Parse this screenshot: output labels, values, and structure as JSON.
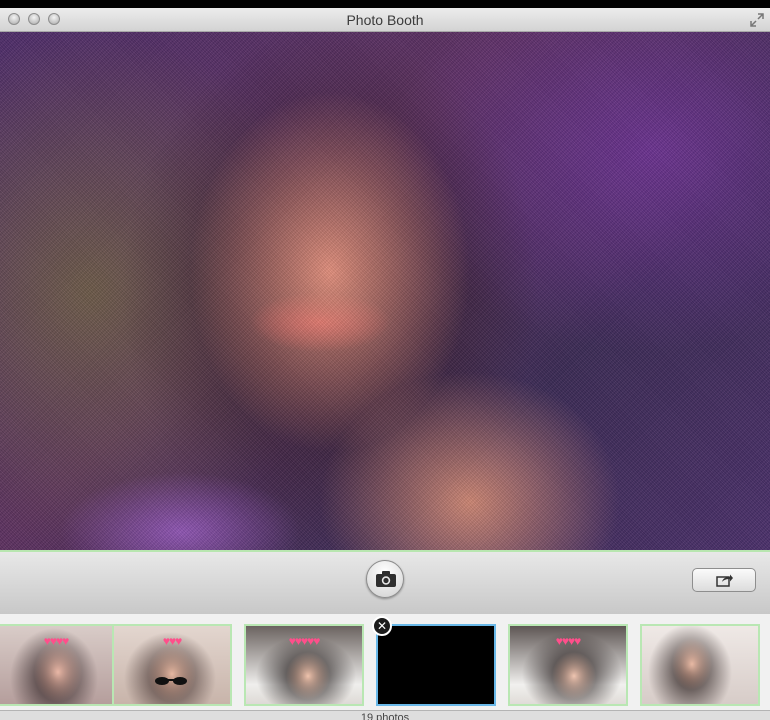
{
  "window": {
    "title": "Photo Booth"
  },
  "toolbar": {
    "capture_icon": "camera-icon",
    "share_icon": "share-icon"
  },
  "strip": {
    "thumbnails": [
      {
        "label": "photo-1",
        "effect": "heart crown"
      },
      {
        "label": "photo-2",
        "effect": "heart crown, sunglasses"
      },
      {
        "label": "photo-3",
        "effect": "heart crown"
      },
      {
        "label": "photo-4",
        "effect": "black / selected"
      },
      {
        "label": "photo-5",
        "effect": "heart crown"
      },
      {
        "label": "photo-6",
        "effect": "none"
      }
    ],
    "delete_glyph": "✕"
  },
  "status": {
    "count_text": "19 photos"
  },
  "colors": {
    "selection_border": "#69b8e8",
    "thumb_border": "#b9e7b3",
    "heart": "#ff4f8b"
  }
}
